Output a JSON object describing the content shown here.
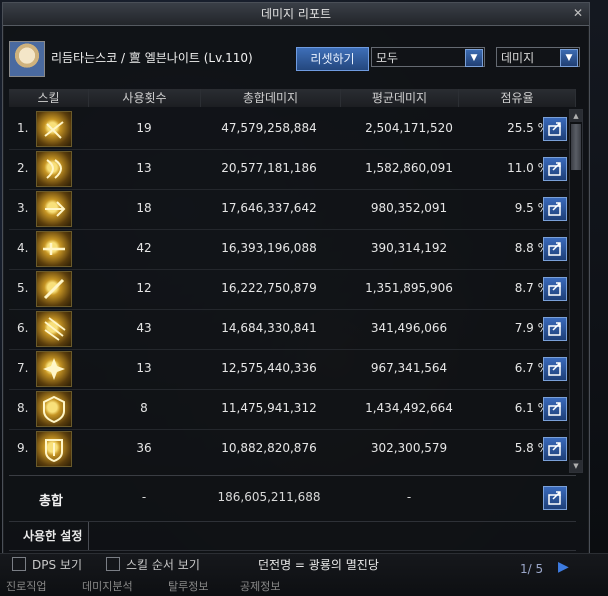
{
  "window": {
    "title": "데미지 리포트",
    "character": "리듬타는스코 / 亶 엘븐나이트 (Lv.110)",
    "reset_label": "리셋하기",
    "filter_1": "모두",
    "filter_2": "데미지"
  },
  "columns": [
    "스킬",
    "사용횟수",
    "총합데미지",
    "평균데미지",
    "점유율"
  ],
  "rows": [
    {
      "num": "1.",
      "uses": "19",
      "total": "47,579,258,884",
      "avg": "2,504,171,520",
      "share": "25.5 %"
    },
    {
      "num": "2.",
      "uses": "13",
      "total": "20,577,181,186",
      "avg": "1,582,860,091",
      "share": "11.0 %"
    },
    {
      "num": "3.",
      "uses": "18",
      "total": "17,646,337,642",
      "avg": "980,352,091",
      "share": "9.5 %"
    },
    {
      "num": "4.",
      "uses": "42",
      "total": "16,393,196,088",
      "avg": "390,314,192",
      "share": "8.8 %"
    },
    {
      "num": "5.",
      "uses": "12",
      "total": "16,222,750,879",
      "avg": "1,351,895,906",
      "share": "8.7 %"
    },
    {
      "num": "6.",
      "uses": "43",
      "total": "14,684,330,841",
      "avg": "341,496,066",
      "share": "7.9 %"
    },
    {
      "num": "7.",
      "uses": "13",
      "total": "12,575,440,336",
      "avg": "967,341,564",
      "share": "6.7 %"
    },
    {
      "num": "8.",
      "uses": "8",
      "total": "11,475,941,312",
      "avg": "1,434,492,664",
      "share": "6.1 %"
    },
    {
      "num": "9.",
      "uses": "36",
      "total": "10,882,820,876",
      "avg": "302,300,579",
      "share": "5.8 %"
    }
  ],
  "summary": {
    "label": "총합",
    "uses": "-",
    "total": "186,605,211,688",
    "avg": "-"
  },
  "tab_label": "사용한 설정",
  "footer": {
    "dps_label": "DPS 보기",
    "skill_order_label": "스킬 순서 보기",
    "dungeon": "던전명 = 광룡의 멸진당",
    "page": "1/ 5",
    "menu": [
      "진로직업",
      "데미지분석",
      "탈루정보",
      "공제정보"
    ]
  }
}
